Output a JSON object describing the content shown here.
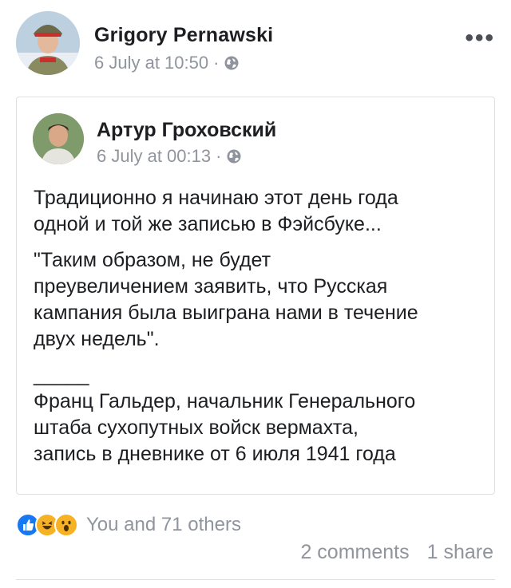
{
  "post": {
    "author": "Grigory Pernawski",
    "date": "6 July at 10:50",
    "separator": "·",
    "more_label": "•••"
  },
  "shared": {
    "author": "Артур Гроховский",
    "date": "6 July at 00:13",
    "separator": "·",
    "paragraphs": [
      [
        "Традиционно я начинаю этот день года",
        "одной и той же записью в Фэйсбуке..."
      ],
      [
        "\"Таким образом, не будет",
        "преувеличением заявить, что Русская",
        "кампания была выиграна нами в течение",
        "двух недель\"."
      ],
      [
        "_____",
        "Франц Гальдер, начальник Генерального",
        "штаба сухопутных войск вермахта,",
        "запись в дневнике от 6 июля 1941 года"
      ]
    ]
  },
  "reactions": {
    "icons": [
      "like-icon",
      "haha-icon",
      "wow-icon"
    ],
    "text": "You and 71 others",
    "colors": {
      "like": "#1877f2",
      "haha": "#f7b125",
      "wow": "#f7b125"
    }
  },
  "stats": {
    "comments": "2 comments",
    "shares": "1 share"
  }
}
